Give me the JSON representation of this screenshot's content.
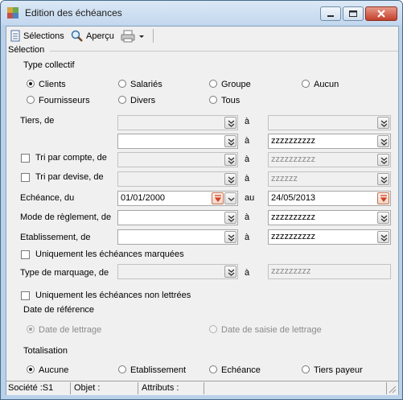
{
  "window": {
    "title": "Edition des échéances"
  },
  "toolbar": {
    "selections_label": "Sélections",
    "apercu_label": "Aperçu"
  },
  "selection_header": "Sélection",
  "type_collectif": {
    "label": "Type collectif",
    "options": [
      {
        "label": "Clients",
        "checked": true
      },
      {
        "label": "Salariés",
        "checked": false
      },
      {
        "label": "Groupe",
        "checked": false
      },
      {
        "label": "Aucun",
        "checked": false
      },
      {
        "label": "Fournisseurs",
        "checked": false
      },
      {
        "label": "Divers",
        "checked": false
      },
      {
        "label": "Tous",
        "checked": false
      }
    ]
  },
  "tiers": {
    "label": "Tiers, de",
    "a": "à",
    "row1_to": "",
    "row2_to": "zzzzzzzzzz"
  },
  "tri_compte": {
    "label": "Tri par compte, de",
    "a": "à",
    "to": "zzzzzzzzzz"
  },
  "tri_devise": {
    "label": "Tri par devise, de",
    "a": "à",
    "to": "zzzzzz"
  },
  "echeance": {
    "label": "Echéance, du",
    "from": "01/01/2000",
    "au": "au",
    "to": "24/05/2013"
  },
  "mode_reglement": {
    "label": "Mode de règlement, de",
    "a": "à",
    "to": "zzzzzzzzzz"
  },
  "etablissement": {
    "label": "Etablissement, de",
    "a": "à",
    "to": "zzzzzzzzzz"
  },
  "uniquement_marquees": {
    "label": "Uniquement les échéances marquées"
  },
  "type_marquage": {
    "label": "Type de marquage, de",
    "a": "à",
    "to": "zzzzzzzzz"
  },
  "uniquement_non_lettrees": {
    "label": "Uniquement les échéances non lettrées"
  },
  "date_reference": {
    "label": "Date de référence",
    "options": [
      {
        "label": "Date de lettrage",
        "checked": true
      },
      {
        "label": "Date de saisie de lettrage",
        "checked": false
      }
    ]
  },
  "totalisation": {
    "label": "Totalisation",
    "options": [
      {
        "label": "Aucune",
        "checked": true
      },
      {
        "label": "Etablissement",
        "checked": false
      },
      {
        "label": "Echéance",
        "checked": false
      },
      {
        "label": "Tiers payeur",
        "checked": false
      }
    ]
  },
  "status": {
    "societe": "Société :S1",
    "objet": "Objet :",
    "attributs": "Attributs :"
  }
}
